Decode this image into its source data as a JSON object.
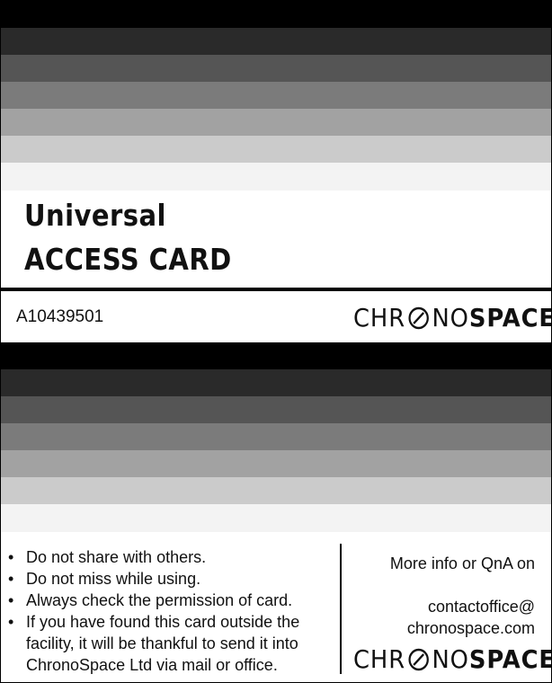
{
  "card": {
    "title_line1": "Universal",
    "title_line2": "ACCESS CARD",
    "card_id": "A10439501"
  },
  "brand": {
    "logo_left": "CHR",
    "logo_right_light": "NO",
    "logo_right_bold": "SPACE"
  },
  "stripe_colors": [
    "#000000",
    "#2a2a2a",
    "#555555",
    "#7b7b7b",
    "#a2a2a2",
    "#cbcbcb",
    "#f3f3f3"
  ],
  "rules": [
    "Do not share with others.",
    "Do not miss while using.",
    "Always check the permission of card.",
    "If you have found this card outside the facility, it will be thankful to send it into ChronoSpace Ltd via mail or office."
  ],
  "contact": {
    "heading": "More info or QnA on",
    "email_line1": "contactoffice@",
    "email_line2": "chronospace.com"
  },
  "bullet": "•"
}
